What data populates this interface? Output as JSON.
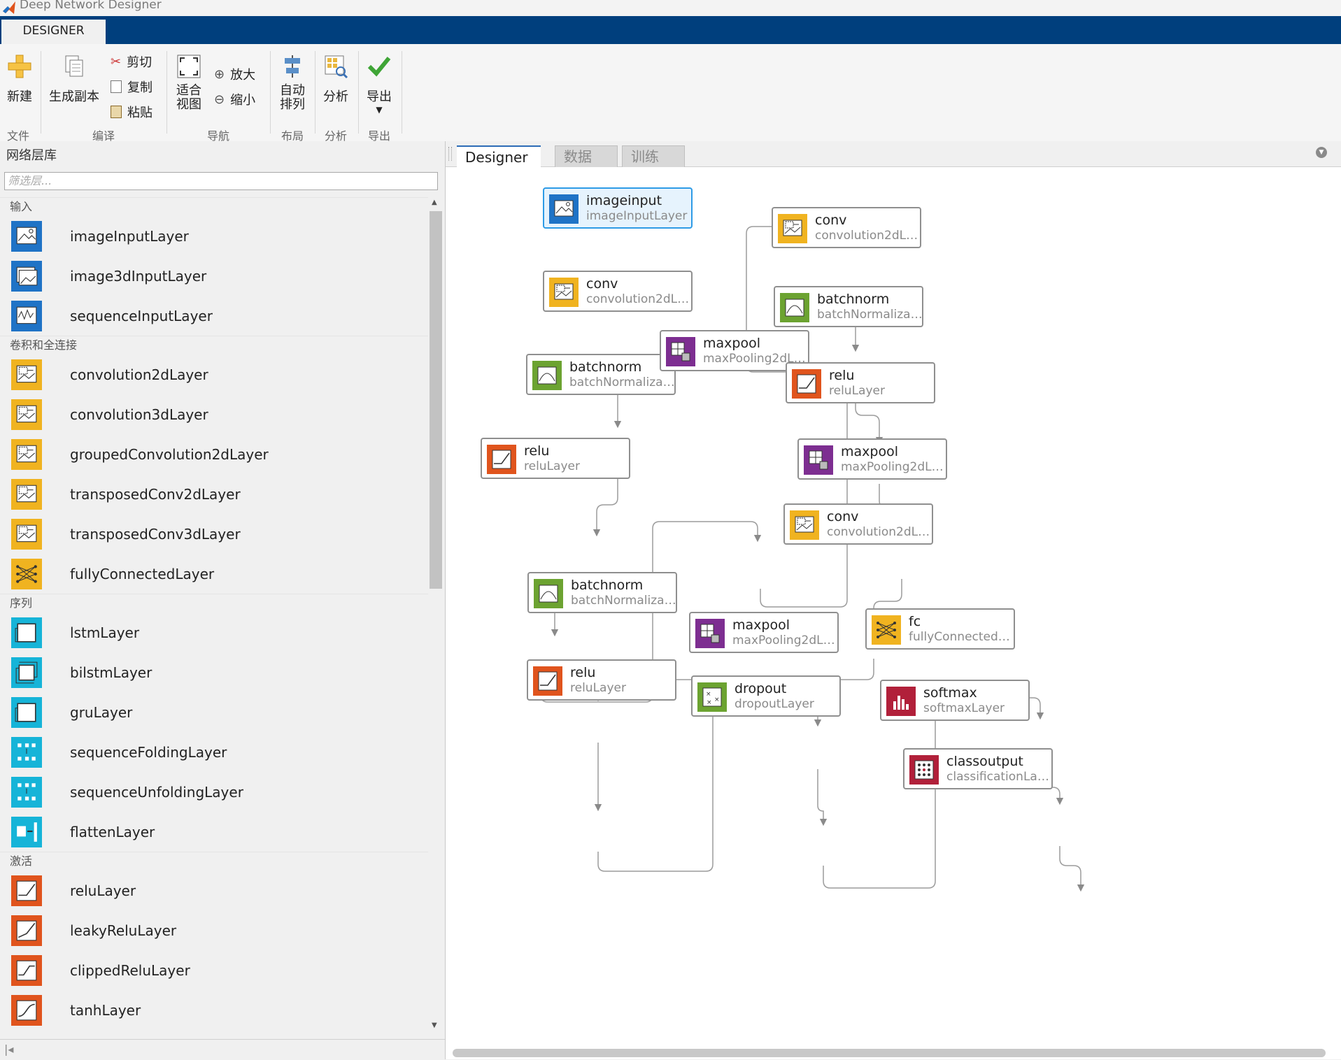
{
  "window": {
    "title": "Deep Network Designer"
  },
  "top_tab": "DESIGNER",
  "ribbon": {
    "new": "新建",
    "duplicate": "生成副本",
    "cut": "剪切",
    "copy": "复制",
    "paste": "粘贴",
    "fit_view_1": "适合",
    "fit_view_2": "视图",
    "zoom_in": "放大",
    "zoom_out": "缩小",
    "auto_arrange_1": "自动",
    "auto_arrange_2": "排列",
    "analyze": "分析",
    "export": "导出",
    "sections": {
      "file": "文件",
      "edit": "编译",
      "navigate": "导航",
      "layout": "布局",
      "analysis": "分析",
      "export": "导出"
    }
  },
  "library": {
    "title": "网络层库",
    "filter_placeholder": "筛选层...",
    "categories": [
      {
        "name": "输入",
        "items": [
          {
            "label": "imageInputLayer",
            "color": "#1f73c6"
          },
          {
            "label": "image3dInputLayer",
            "color": "#1f73c6"
          },
          {
            "label": "sequenceInputLayer",
            "color": "#1f73c6"
          }
        ]
      },
      {
        "name": "卷积和全连接",
        "items": [
          {
            "label": "convolution2dLayer",
            "color": "#f0b320"
          },
          {
            "label": "convolution3dLayer",
            "color": "#f0b320"
          },
          {
            "label": "groupedConvolution2dLayer",
            "color": "#f0b320"
          },
          {
            "label": "transposedConv2dLayer",
            "color": "#f0b320"
          },
          {
            "label": "transposedConv3dLayer",
            "color": "#f0b320"
          },
          {
            "label": "fullyConnectedLayer",
            "color": "#f0b320"
          }
        ]
      },
      {
        "name": "序列",
        "items": [
          {
            "label": "lstmLayer",
            "color": "#16b4d8"
          },
          {
            "label": "bilstmLayer",
            "color": "#16b4d8"
          },
          {
            "label": "gruLayer",
            "color": "#16b4d8"
          },
          {
            "label": "sequenceFoldingLayer",
            "color": "#16b4d8"
          },
          {
            "label": "sequenceUnfoldingLayer",
            "color": "#16b4d8"
          },
          {
            "label": "flattenLayer",
            "color": "#16b4d8"
          }
        ]
      },
      {
        "name": "激活",
        "items": [
          {
            "label": "reluLayer",
            "color": "#e0541d"
          },
          {
            "label": "leakyReluLayer",
            "color": "#e0541d"
          },
          {
            "label": "clippedReluLayer",
            "color": "#e0541d"
          },
          {
            "label": "tanhLayer",
            "color": "#e0541d"
          }
        ]
      }
    ]
  },
  "designer_tabs": [
    "Designer",
    "数据",
    "训练"
  ],
  "nodes": [
    {
      "name": "imageinput",
      "type": "imageInputLayer",
      "kind": "input",
      "selected": true
    },
    {
      "name": "conv",
      "type": "convolution2dL…",
      "kind": "conv"
    },
    {
      "name": "batchnorm",
      "type": "batchNormaliza…",
      "kind": "bn"
    },
    {
      "name": "relu",
      "type": "reluLayer",
      "kind": "relu"
    },
    {
      "name": "maxpool",
      "type": "maxPooling2dL…",
      "kind": "pool"
    },
    {
      "name": "conv",
      "type": "convolution2dL…",
      "kind": "conv"
    },
    {
      "name": "batchnorm",
      "type": "batchNormaliza…",
      "kind": "bn"
    },
    {
      "name": "relu",
      "type": "reluLayer",
      "kind": "relu"
    },
    {
      "name": "maxpool",
      "type": "maxPooling2dL…",
      "kind": "pool"
    },
    {
      "name": "conv",
      "type": "convolution2dL…",
      "kind": "conv"
    },
    {
      "name": "batchnorm",
      "type": "batchNormaliza…",
      "kind": "bn"
    },
    {
      "name": "relu",
      "type": "reluLayer",
      "kind": "relu"
    },
    {
      "name": "maxpool",
      "type": "maxPooling2dL…",
      "kind": "pool"
    },
    {
      "name": "dropout",
      "type": "dropoutLayer",
      "kind": "dropout"
    },
    {
      "name": "fc",
      "type": "fullyConnected…",
      "kind": "fc"
    },
    {
      "name": "softmax",
      "type": "softmaxLayer",
      "kind": "softmax"
    },
    {
      "name": "classoutput",
      "type": "classificationLa…",
      "kind": "output"
    }
  ]
}
